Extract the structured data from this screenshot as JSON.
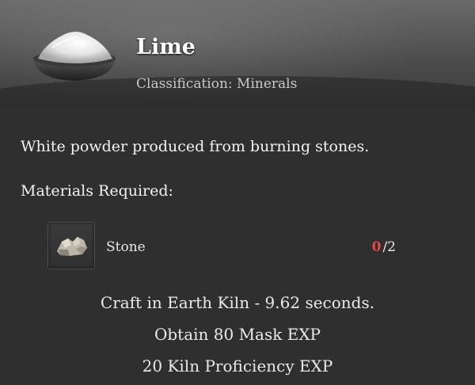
{
  "item": {
    "name": "Lime",
    "classification": "Classification: Minerals",
    "icon": "lime-powder-bowl-icon"
  },
  "description": "White powder produced from burning stones.",
  "materials_label": "Materials Required:",
  "materials": [
    {
      "name": "Stone",
      "icon": "stone-icon",
      "have": "0",
      "separator": "/",
      "need": "2"
    }
  ],
  "info_lines": [
    "Craft in Earth Kiln - 9.62 seconds.",
    "Obtain 80 Mask EXP",
    "20 Kiln Proficiency EXP"
  ],
  "colors": {
    "insufficient": "#e04848",
    "background": "#2f2f2f"
  }
}
